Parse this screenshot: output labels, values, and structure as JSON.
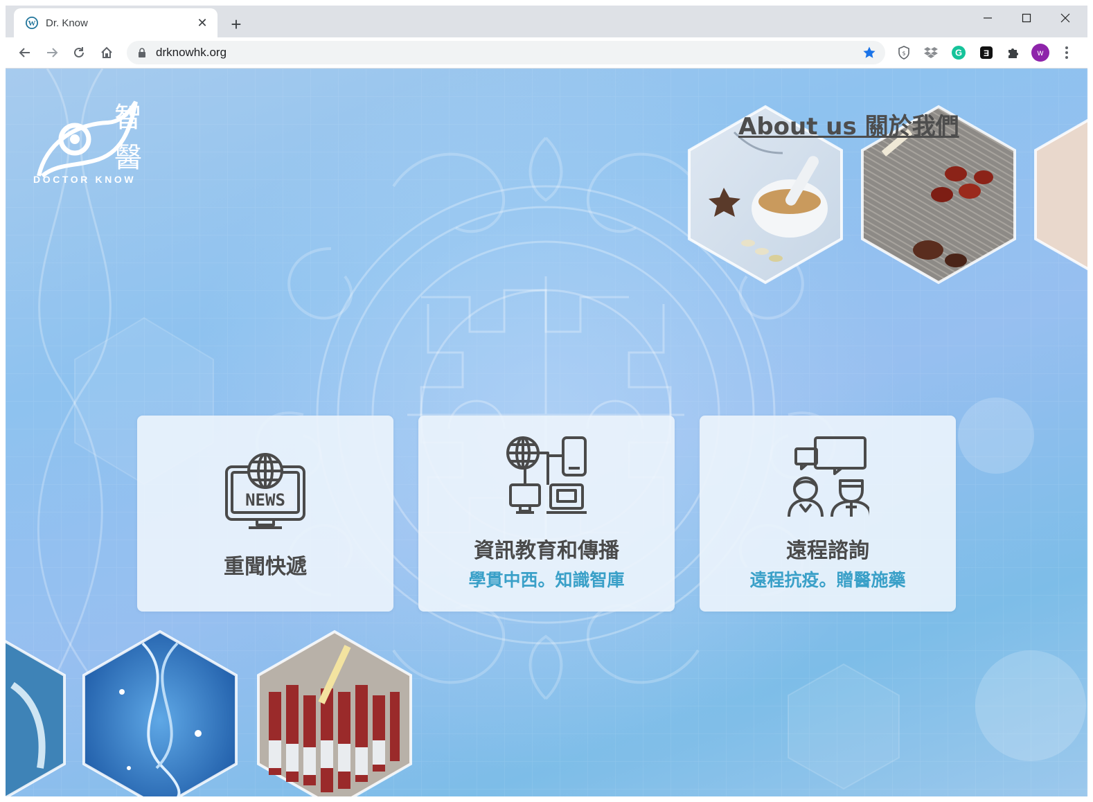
{
  "browser": {
    "tab_title": "Dr. Know",
    "url": "drknowhk.org",
    "profile_initial": "w",
    "icons": {
      "favicon": "wordpress-icon",
      "close": "close-icon",
      "new_tab": "plus-icon",
      "back": "back-arrow-icon",
      "forward": "forward-arrow-icon",
      "reload": "reload-icon",
      "home": "home-icon",
      "lock": "lock-icon",
      "bookmark": "star-icon",
      "extensions": [
        "shield-icon",
        "dropbox-icon",
        "grammarly-icon",
        "ghostery-icon",
        "puzzle-icon"
      ],
      "menu": "kebab-menu-icon"
    },
    "colors": {
      "bookmark_star": "#1a73e8",
      "grammarly": "#15c39a",
      "profile": "#8e24aa"
    }
  },
  "site": {
    "logo": {
      "cn_line1": "智",
      "cn_line2": "醫",
      "en": "DOCTOR KNOW"
    },
    "about_link": "About us 關於我們",
    "cards": [
      {
        "title": "重聞快遞",
        "subtitle": "",
        "icon": "news-monitor-icon"
      },
      {
        "title": "資訊教育和傳播",
        "subtitle": "學貫中西。知識智庫",
        "icon": "network-devices-icon"
      },
      {
        "title": "遠程諮詢",
        "subtitle": "遠程抗疫。贈醫施藥",
        "icon": "consultation-people-icon"
      }
    ],
    "colors": {
      "subtitle": "#3aa0c8",
      "title": "#4a4a4a",
      "about": "#4d4d4d"
    }
  }
}
